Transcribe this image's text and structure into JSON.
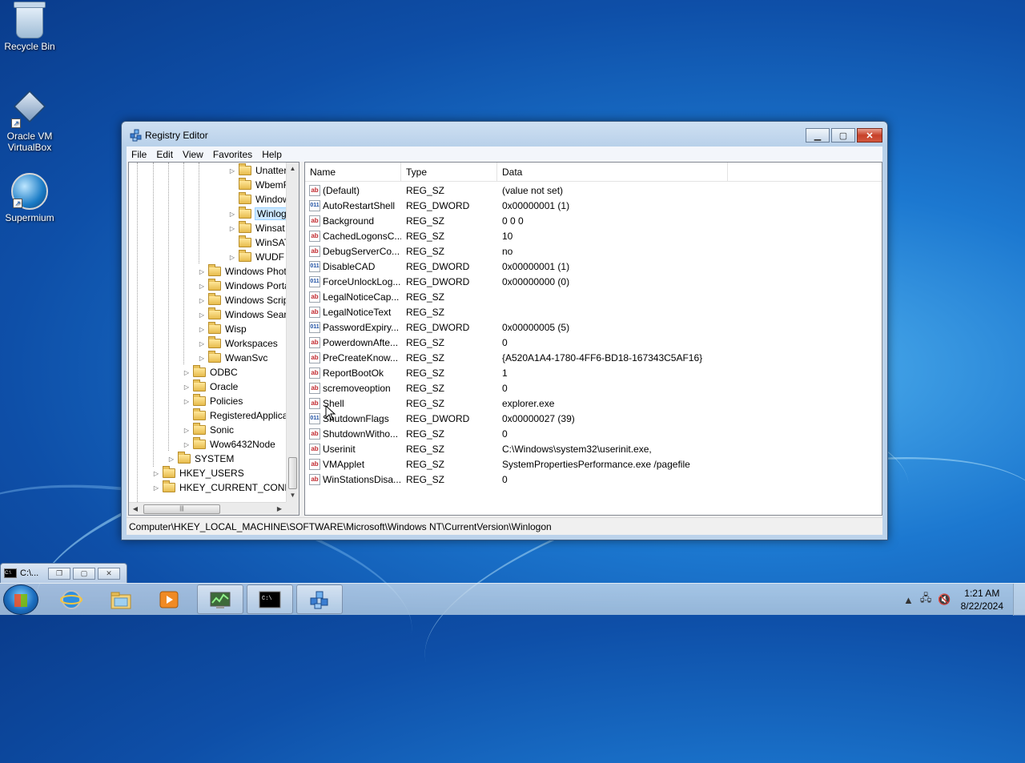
{
  "desktop": {
    "icons": [
      {
        "label": "Recycle Bin"
      },
      {
        "label": "Oracle VM VirtualBox"
      },
      {
        "label": "Supermium"
      }
    ]
  },
  "window": {
    "title": "Registry Editor",
    "menu": [
      "File",
      "Edit",
      "View",
      "Favorites",
      "Help"
    ],
    "tree": [
      {
        "label": "Unatter",
        "selected": false
      },
      {
        "label": "WbemF",
        "selected": false
      },
      {
        "label": "Window",
        "selected": false
      },
      {
        "label": "Winlog",
        "selected": true
      },
      {
        "label": "Winsat",
        "selected": false
      },
      {
        "label": "WinSAT",
        "selected": false
      },
      {
        "label": "WUDF",
        "selected": false
      },
      {
        "label": "Windows Phot",
        "selected": false
      },
      {
        "label": "Windows Porta",
        "selected": false
      },
      {
        "label": "Windows Scrip",
        "selected": false
      },
      {
        "label": "Windows Sear",
        "selected": false
      },
      {
        "label": "Wisp",
        "selected": false
      },
      {
        "label": "Workspaces",
        "selected": false
      },
      {
        "label": "WwanSvc",
        "selected": false
      },
      {
        "label": "ODBC",
        "selected": false
      },
      {
        "label": "Oracle",
        "selected": false
      },
      {
        "label": "Policies",
        "selected": false
      },
      {
        "label": "RegisteredApplica",
        "selected": false
      },
      {
        "label": "Sonic",
        "selected": false
      },
      {
        "label": "Wow6432Node",
        "selected": false
      },
      {
        "label": "SYSTEM",
        "selected": false
      },
      {
        "label": "HKEY_USERS",
        "selected": false
      },
      {
        "label": "HKEY_CURRENT_CONFIG",
        "selected": false
      }
    ],
    "columns": [
      "Name",
      "Type",
      "Data"
    ],
    "values": [
      {
        "name": "(Default)",
        "type": "REG_SZ",
        "data": "(value not set)",
        "icon": "string-value-icon"
      },
      {
        "name": "AutoRestartShell",
        "type": "REG_DWORD",
        "data": "0x00000001 (1)",
        "icon": "dword-value-icon"
      },
      {
        "name": "Background",
        "type": "REG_SZ",
        "data": "0 0 0",
        "icon": "string-value-icon"
      },
      {
        "name": "CachedLogonsC...",
        "type": "REG_SZ",
        "data": "10",
        "icon": "string-value-icon"
      },
      {
        "name": "DebugServerCo...",
        "type": "REG_SZ",
        "data": "no",
        "icon": "string-value-icon"
      },
      {
        "name": "DisableCAD",
        "type": "REG_DWORD",
        "data": "0x00000001 (1)",
        "icon": "dword-value-icon"
      },
      {
        "name": "ForceUnlockLog...",
        "type": "REG_DWORD",
        "data": "0x00000000 (0)",
        "icon": "dword-value-icon"
      },
      {
        "name": "LegalNoticeCap...",
        "type": "REG_SZ",
        "data": "",
        "icon": "string-value-icon"
      },
      {
        "name": "LegalNoticeText",
        "type": "REG_SZ",
        "data": "",
        "icon": "string-value-icon"
      },
      {
        "name": "PasswordExpiry...",
        "type": "REG_DWORD",
        "data": "0x00000005 (5)",
        "icon": "dword-value-icon"
      },
      {
        "name": "PowerdownAfte...",
        "type": "REG_SZ",
        "data": "0",
        "icon": "string-value-icon"
      },
      {
        "name": "PreCreateKnow...",
        "type": "REG_SZ",
        "data": "{A520A1A4-1780-4FF6-BD18-167343C5AF16}",
        "icon": "string-value-icon"
      },
      {
        "name": "ReportBootOk",
        "type": "REG_SZ",
        "data": "1",
        "icon": "string-value-icon"
      },
      {
        "name": "scremoveoption",
        "type": "REG_SZ",
        "data": "0",
        "icon": "string-value-icon"
      },
      {
        "name": "Shell",
        "type": "REG_SZ",
        "data": "explorer.exe",
        "icon": "string-value-icon"
      },
      {
        "name": "ShutdownFlags",
        "type": "REG_DWORD",
        "data": "0x00000027 (39)",
        "icon": "dword-value-icon"
      },
      {
        "name": "ShutdownWitho...",
        "type": "REG_SZ",
        "data": "0",
        "icon": "string-value-icon"
      },
      {
        "name": "Userinit",
        "type": "REG_SZ",
        "data": "C:\\Windows\\system32\\userinit.exe,",
        "icon": "string-value-icon"
      },
      {
        "name": "VMApplet",
        "type": "REG_SZ",
        "data": "SystemPropertiesPerformance.exe /pagefile",
        "icon": "string-value-icon"
      },
      {
        "name": "WinStationsDisa...",
        "type": "REG_SZ",
        "data": "0",
        "icon": "string-value-icon"
      }
    ],
    "status_path": "Computer\\HKEY_LOCAL_MACHINE\\SOFTWARE\\Microsoft\\Windows NT\\CurrentVersion\\Winlogon"
  },
  "mini_window": {
    "title": "C:\\..."
  },
  "taskbar": {
    "buttons": [
      "internet-explorer-icon",
      "windows-explorer-icon",
      "media-player-icon",
      "system-monitor-icon",
      "command-prompt-icon",
      "registry-editor-icon"
    ],
    "clock_time": "1:21 AM",
    "clock_date": "8/22/2024"
  }
}
